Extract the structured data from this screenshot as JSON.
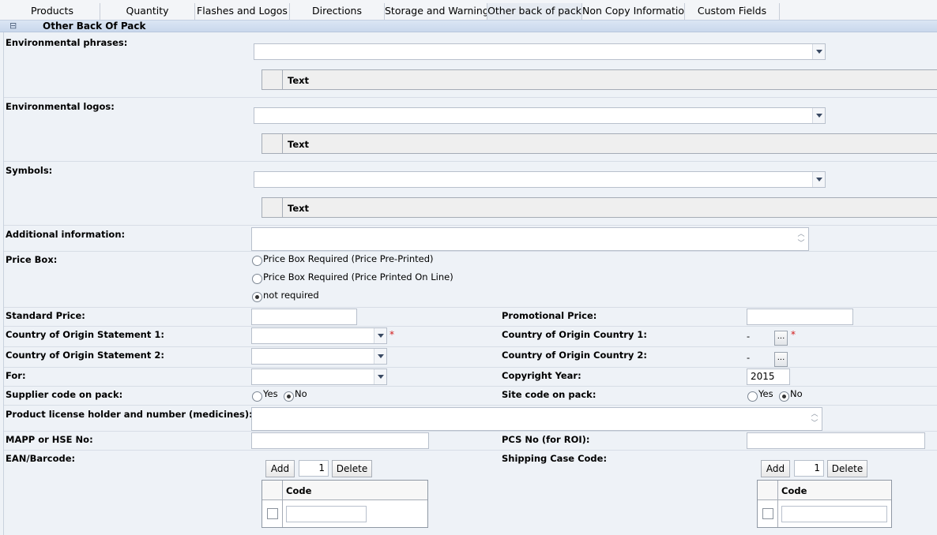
{
  "tabs": [
    "Products",
    "Quantity",
    "Flashes and Logos",
    "Directions",
    "Storage and Warnings",
    "Other back of pack",
    "Non Copy Information",
    "Custom Fields"
  ],
  "section": {
    "collapse_icon": "⊟",
    "title": "Other Back Of Pack"
  },
  "env_phrases": {
    "label": "Environmental phrases:",
    "grid_header": "Text"
  },
  "env_logos": {
    "label": "Environmental logos:",
    "grid_header": "Text"
  },
  "symbols": {
    "label": "Symbols:",
    "grid_header": "Text"
  },
  "additional_info": {
    "label": "Additional information:",
    "value": ""
  },
  "price_box": {
    "label": "Price Box:",
    "options": [
      "Price Box Required (Price Pre-Printed)",
      "Price Box Required (Price Printed On Line)",
      "not required"
    ],
    "selected": "not required"
  },
  "standard_price": {
    "label": "Standard Price:",
    "value": ""
  },
  "promotional_price": {
    "label": "Promotional Price:",
    "value": ""
  },
  "coo_statement_1": {
    "label": "Country of Origin Statement 1:",
    "required": "*"
  },
  "coo_country_1": {
    "label": "Country of Origin Country 1:",
    "value": "-",
    "button": "...",
    "required": "*"
  },
  "coo_statement_2": {
    "label": "Country of Origin Statement 2:"
  },
  "coo_country_2": {
    "label": "Country of Origin Country 2:",
    "value": "-",
    "button": "..."
  },
  "for_field": {
    "label": "For:"
  },
  "copyright_year": {
    "label": "Copyright Year:",
    "value": "2015"
  },
  "supplier_code": {
    "label": "Supplier code on pack:",
    "yes": "Yes",
    "no": "No",
    "selected": "No"
  },
  "site_code": {
    "label": "Site code on pack:",
    "yes": "Yes",
    "no": "No",
    "selected": "No"
  },
  "license": {
    "label": "Product license holder and number (medicines):",
    "value": ""
  },
  "mapp": {
    "label": "MAPP or HSE No:",
    "value": ""
  },
  "pcs": {
    "label": "PCS No (for ROI):",
    "value": ""
  },
  "ean": {
    "label": "EAN/Barcode:",
    "add": "Add",
    "count": "1",
    "delete": "Delete",
    "col": "Code"
  },
  "shipping": {
    "label": "Shipping Case Code:",
    "add": "Add",
    "count": "1",
    "delete": "Delete",
    "col": "Code"
  }
}
